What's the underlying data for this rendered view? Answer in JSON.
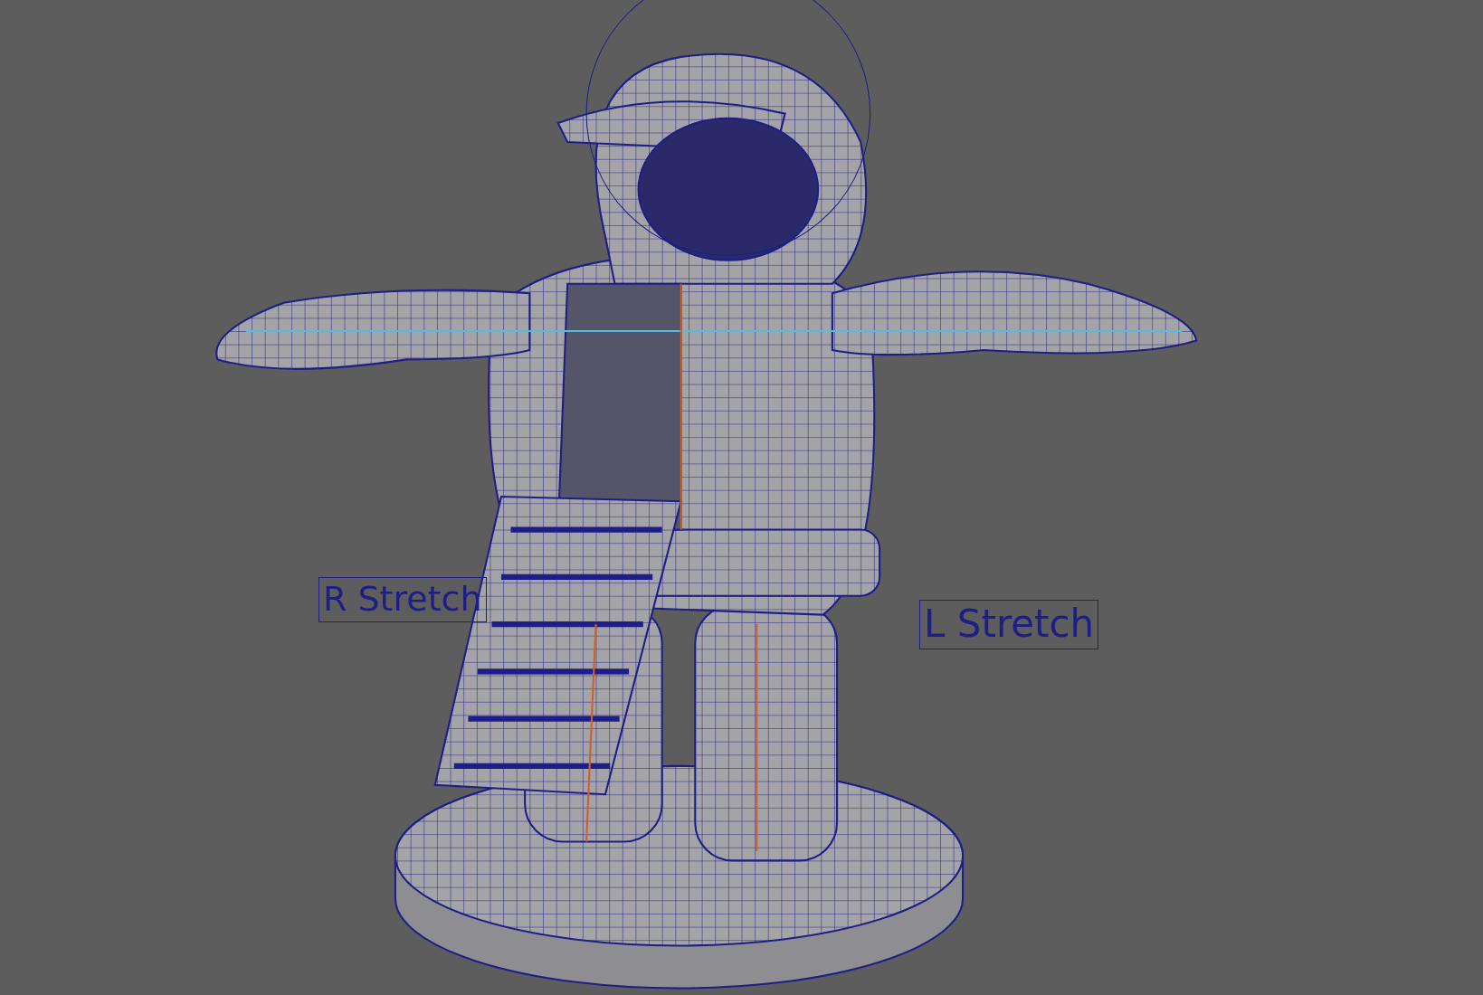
{
  "viewport": {
    "labels": [
      {
        "text": "R Stretch"
      },
      {
        "text": "L Stretch"
      }
    ]
  }
}
